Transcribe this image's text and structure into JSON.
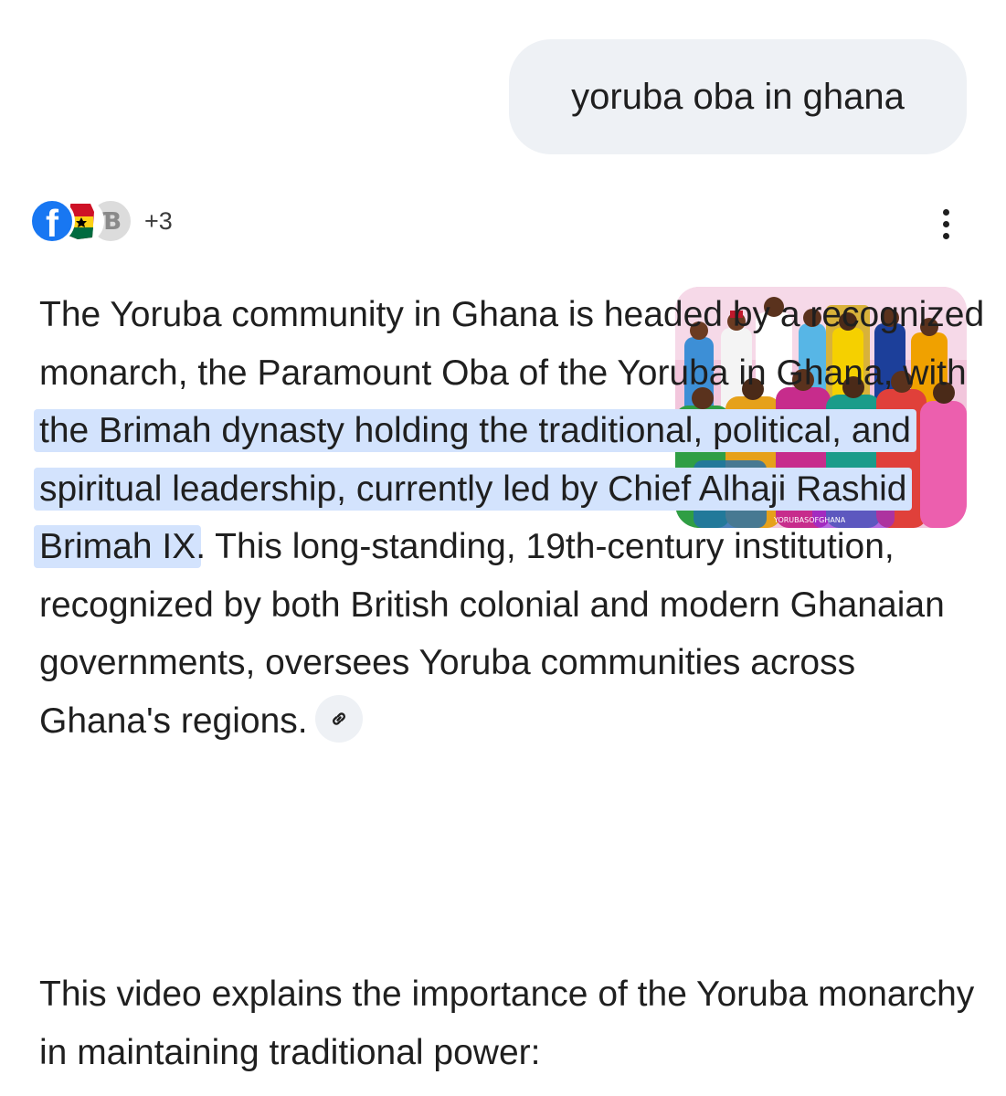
{
  "query": {
    "text": "yoruba oba in ghana"
  },
  "sources": {
    "icons": [
      "facebook-icon",
      "ghana-map-icon",
      "site-icon"
    ],
    "more_count": "+3"
  },
  "colors": {
    "highlight": "#d3e3fd",
    "bubble": "#eef1f5",
    "facebook": "#1877f2"
  },
  "answer": {
    "intro": "The Yoruba community in Ghana is headed by a recognized monarch, the Paramount Oba of the Yoruba in Ghana, with ",
    "highlight": "the Brimah dynasty holding the traditional, political, and spiritual leadership, currently led by Chief Alhaji Rashid Brimah IX",
    "rest": ". This long-standing, 19th-century institution, recognized by both British colonial and modern Ghanaian governments, oversees Yoruba communities across Ghana's regions.",
    "image_caption": "YORUBASOFGHANA"
  },
  "video": {
    "intro": "This video explains the importance of the Yoruba monarchy in maintaining traditional power:"
  }
}
